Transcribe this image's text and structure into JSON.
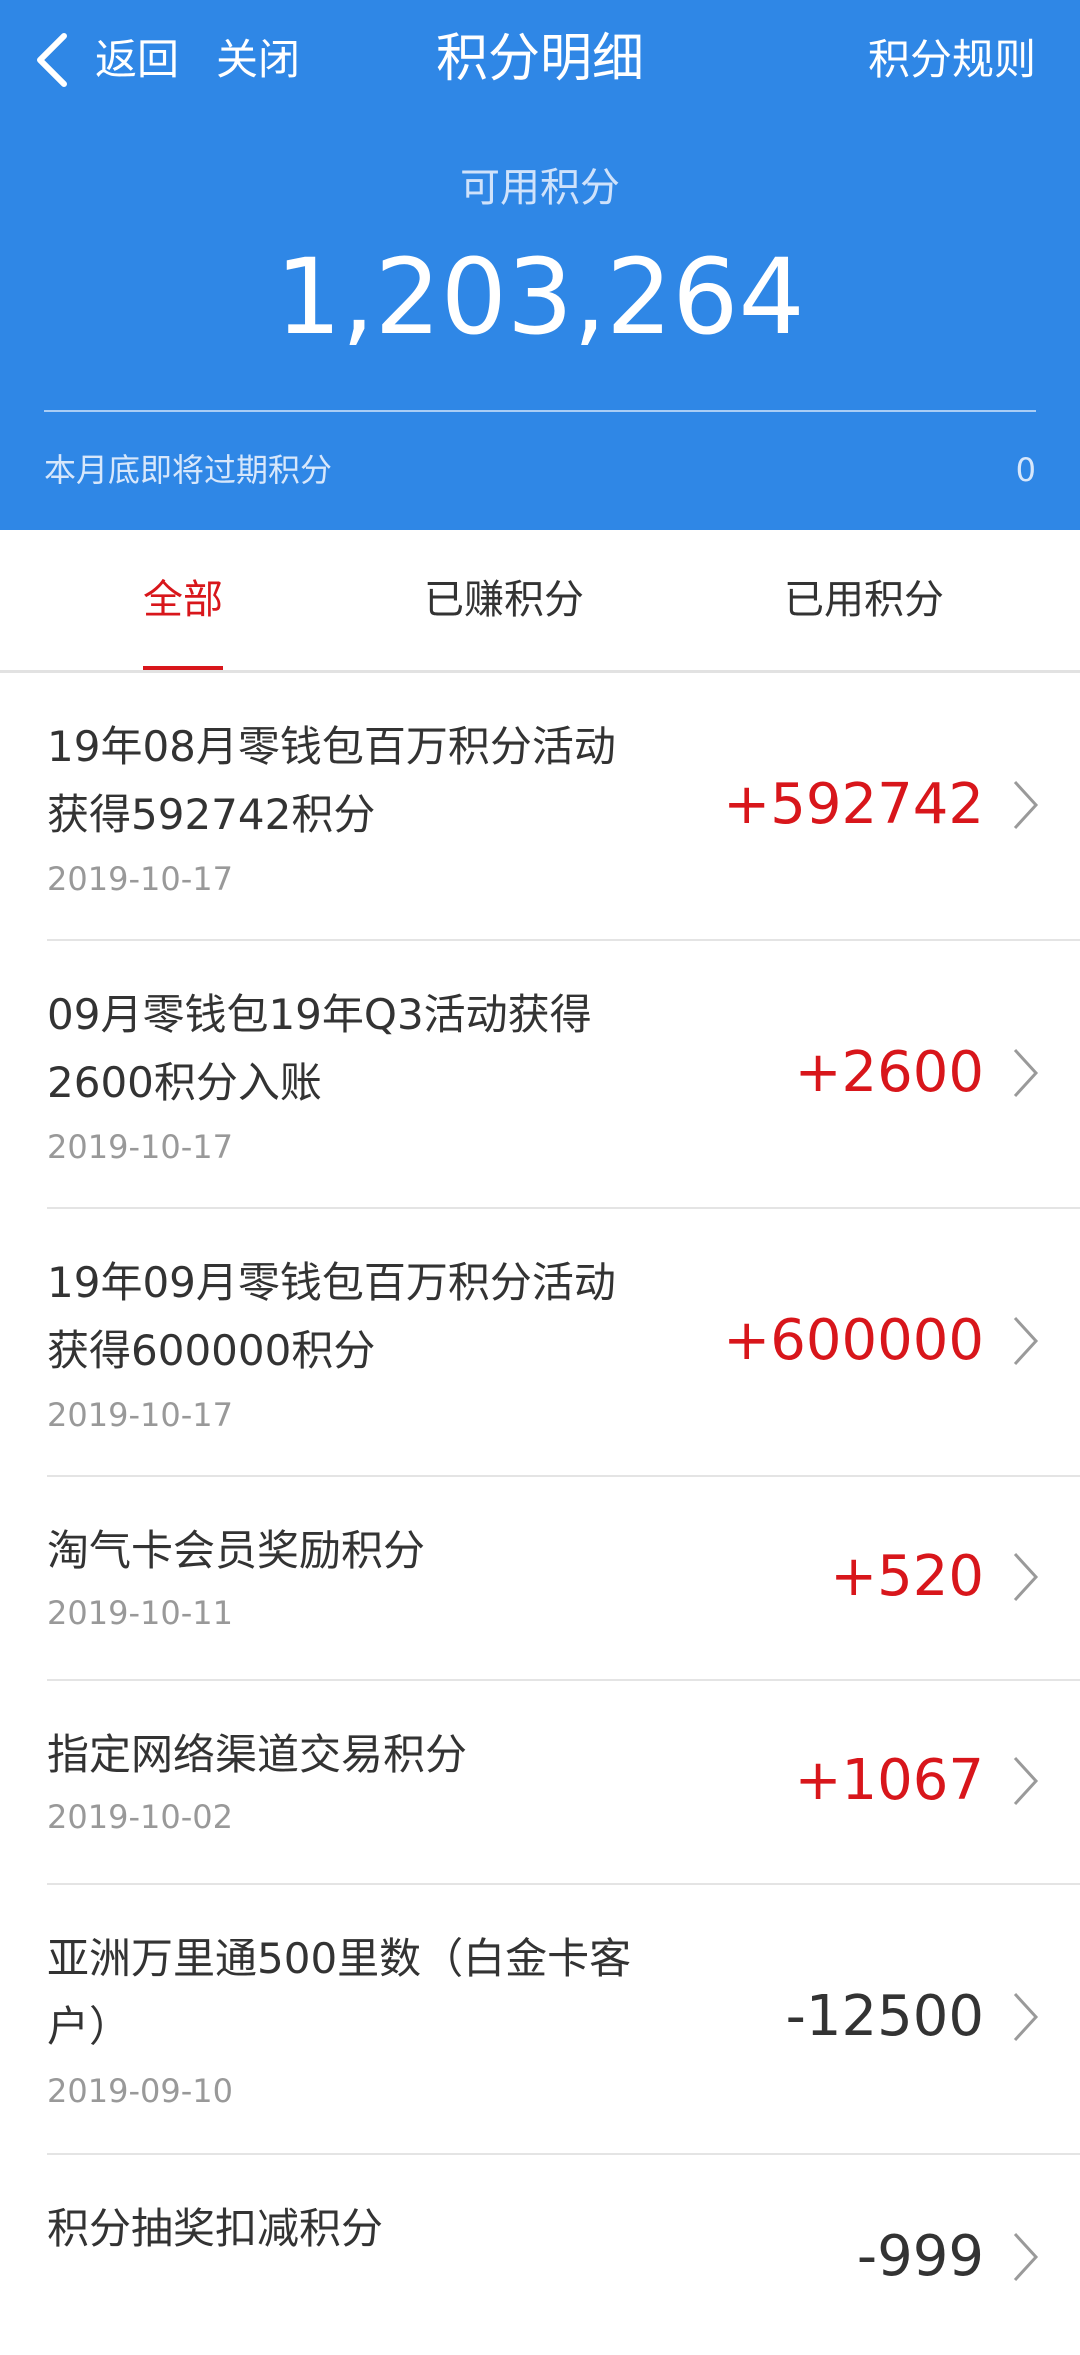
{
  "nav": {
    "back_label": "返回",
    "close_label": "关闭",
    "title": "积分明细",
    "rules_label": "积分规则"
  },
  "balance": {
    "label": "可用积分",
    "value": "1,203,264",
    "expire_label": "本月底即将过期积分",
    "expire_value": "0"
  },
  "tabs": [
    {
      "label": "全部",
      "active": true
    },
    {
      "label": "已赚积分",
      "active": false
    },
    {
      "label": "已用积分",
      "active": false
    }
  ],
  "records": [
    {
      "title": "19年08月零钱包百万积分活动获得592742积分",
      "date": "2019-10-17",
      "amount": "+592742"
    },
    {
      "title": "09月零钱包19年Q3活动获得2600积分入账",
      "date": "2019-10-17",
      "amount": "+2600"
    },
    {
      "title": "19年09月零钱包百万积分活动获得600000积分",
      "date": "2019-10-17",
      "amount": "+600000"
    },
    {
      "title": "淘气卡会员奖励积分",
      "date": "2019-10-11",
      "amount": "+520"
    },
    {
      "title": "指定网络渠道交易积分",
      "date": "2019-10-02",
      "amount": "+1067"
    },
    {
      "title": "亚洲万里通500里数（白金卡客户）",
      "date": "2019-09-10",
      "amount": "-12500"
    },
    {
      "title": "积分抽奖扣减积分",
      "date": "",
      "amount": "-999"
    }
  ],
  "icons": {
    "back": "chevron-left-icon",
    "row": "chevron-right-icon"
  },
  "colors": {
    "header_bg": "#2f87e6",
    "accent_red": "#d8161b",
    "text_dark": "#333333",
    "text_gray": "#999999"
  }
}
